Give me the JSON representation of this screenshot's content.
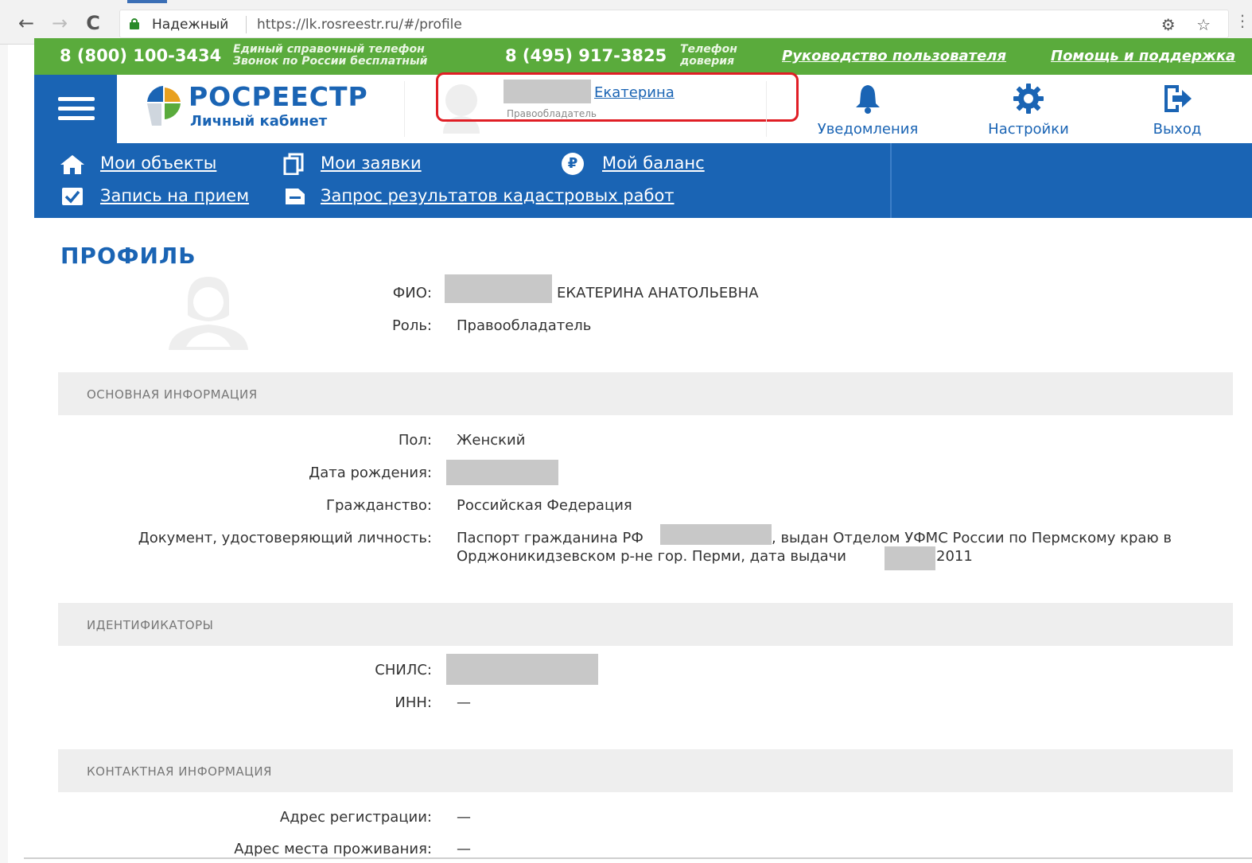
{
  "browser": {
    "back": "←",
    "forward": "→",
    "reload": "C",
    "secure_label": "Надежный",
    "url": "https://lk.rosreestr.ru/#/profile",
    "icons": "⚙ ☆",
    "menu": "⋮"
  },
  "green_bar": {
    "phone1": "8 (800) 100-3434",
    "phone1_note_line1": "Единый справочный телефон",
    "phone1_note_line2": "Звонок по России бесплатный",
    "phone2": "8 (495) 917-3825",
    "phone2_note_line1": "Телефон",
    "phone2_note_line2": "доверия",
    "guide_link": "Руководство пользователя",
    "help_link": "Помощь и поддержка"
  },
  "header": {
    "logo_title": "РОСРЕЕСТР",
    "logo_sub": "Личный кабинет",
    "user_name": "Екатерина",
    "user_role": "Правообладатель",
    "notifications": "Уведомления",
    "settings": "Настройки",
    "logout": "Выход"
  },
  "nav": {
    "my_objects": "Мои объекты",
    "my_requests": "Мои заявки",
    "my_balance": "Мой баланс",
    "appointment": "Запись на прием",
    "cadastral": "Запрос результатов кадастровых работ",
    "balance_icon_letter": "₽"
  },
  "profile": {
    "title": "ПРОФИЛЬ",
    "fio_label": "ФИО:",
    "fio_value": "ЕКАТЕРИНА АНАТОЛЬЕВНА",
    "role_label": "Роль:",
    "role_value": "Правообладатель"
  },
  "sections": {
    "basic": "ОСНОВНАЯ ИНФОРМАЦИЯ",
    "ids": "ИДЕНТИФИКАТОРЫ",
    "contacts": "КОНТАКТНАЯ ИНФОРМАЦИЯ"
  },
  "basic": {
    "gender_label": "Пол:",
    "gender_value": "Женский",
    "birth_label": "Дата рождения:",
    "citizenship_label": "Гражданство:",
    "citizenship_value": "Российская Федерация",
    "doc_label": "Документ, удостоверяющий личность:",
    "doc_part1": "Паспорт гражданина РФ",
    "doc_part2": ", выдан Отделом УФМС России по Пермскому краю в",
    "doc_line2": "Орджоникидзевском р-не гор. Перми, дата выдачи",
    "doc_year": "2011"
  },
  "ids": {
    "snils_label": "СНИЛС:",
    "inn_label": "ИНН:",
    "inn_value": "—"
  },
  "contacts": {
    "reg_label": "Адрес регистрации:",
    "reg_value": "—",
    "live_label": "Адрес места проживания:",
    "live_value": "—"
  },
  "colors": {
    "brand_blue": "#1a64b4",
    "brand_green": "#5aab3c",
    "highlight_red": "#e01e25"
  }
}
